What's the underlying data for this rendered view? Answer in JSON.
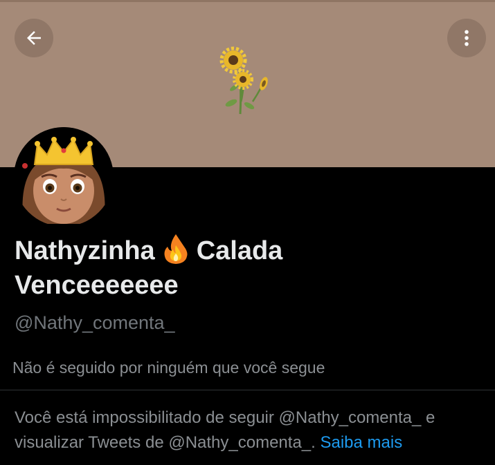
{
  "header": {
    "back_icon": "arrow-left-icon",
    "more_icon": "vertical-dots-icon",
    "banner_color": "#a58a78",
    "banner_art": "sunflowers"
  },
  "profile": {
    "avatar": "princess-emoji",
    "name_line1_part1": "Nathyzinha",
    "name_emoji": "fire-icon",
    "name_line1_part2": "Calada",
    "name_line2": "Venceeeeeee",
    "handle": "@Nathy_comenta_",
    "followers_context": "Não é seguido por ninguém que você segue"
  },
  "notice": {
    "text": "Você está impossibilitado de seguir @Nathy_comenta_ e visualizar Tweets de @Nathy_comenta_.",
    "link_label": "Saiba mais",
    "link_color": "#1d9bf0"
  }
}
